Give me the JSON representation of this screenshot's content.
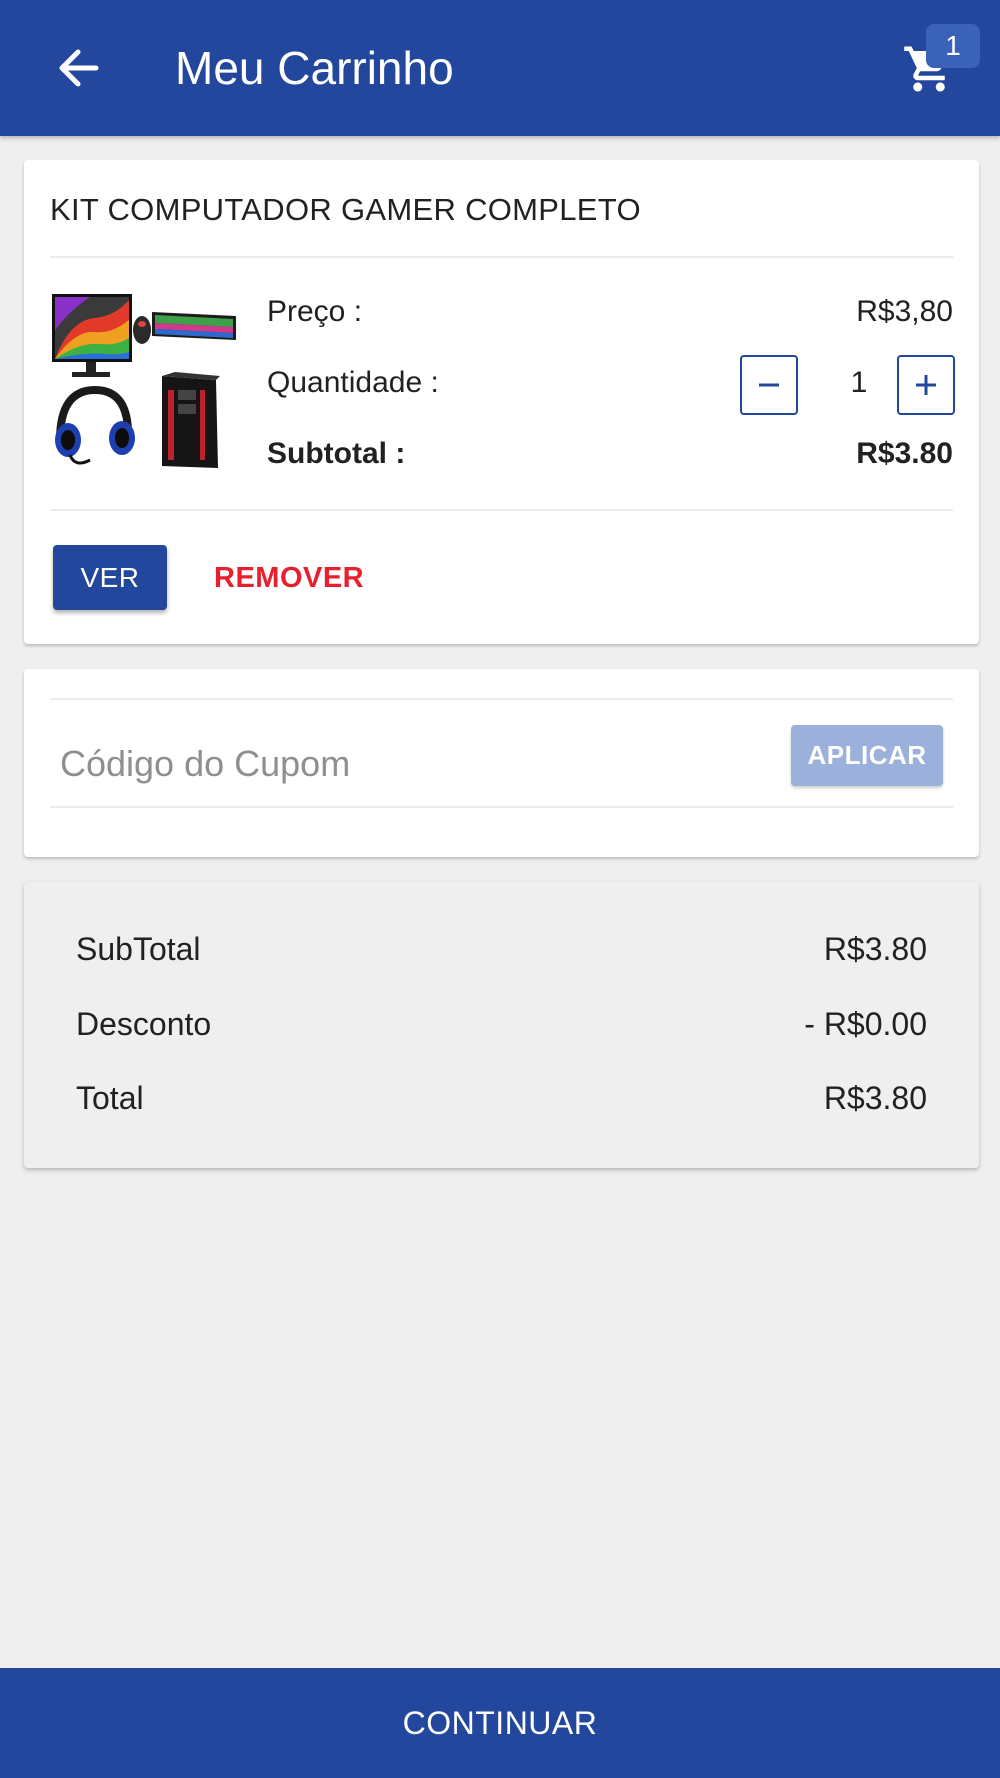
{
  "header": {
    "title": "Meu Carrinho",
    "back_icon": "arrow-left-icon",
    "cart_icon": "cart-icon",
    "cart_count": "1"
  },
  "product": {
    "name": "KIT COMPUTADOR GAMER COMPLETO",
    "price_label": "Preço :",
    "price_value": "R$3,80",
    "quantity_label": "Quantidade :",
    "quantity_value": "1",
    "subtotal_label": "Subtotal :",
    "subtotal_value": "R$3.80",
    "view_label": "VER",
    "remove_label": "REMOVER"
  },
  "coupon": {
    "placeholder": "Código do Cupom",
    "value": "",
    "apply_label": "APLICAR"
  },
  "summary": {
    "subtotal_label": "SubTotal",
    "subtotal_value": "R$3.80",
    "discount_label": "Desconto",
    "discount_value": "- R$0.00",
    "total_label": "Total",
    "total_value": "R$3.80"
  },
  "footer": {
    "continue_label": "CONTINUAR"
  },
  "colors": {
    "primary": "#22479c",
    "danger": "#e8202e",
    "disabled_button": "#9cb0dc",
    "background": "#efefef"
  }
}
